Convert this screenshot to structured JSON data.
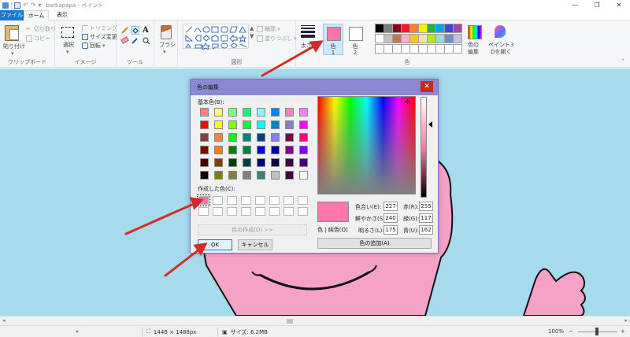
{
  "window": {
    "title": "barbapapa - ペイント",
    "controls": [
      "—",
      "❐",
      "✕"
    ]
  },
  "tabs": {
    "file": "ファイル",
    "home": "ホーム",
    "view": "表示"
  },
  "ribbon": {
    "clipboard": {
      "paste": "貼り付け",
      "cut": "切り取り",
      "copy": "コピー",
      "label": "クリップボード"
    },
    "image": {
      "select": "選択",
      "crop": "トリミング",
      "resize": "サイズ変更",
      "rotate": "回転",
      "label": "イメージ"
    },
    "tools": {
      "label": "ツール"
    },
    "brush": {
      "label": "ブラシ"
    },
    "shapes": {
      "outline": "輪郭",
      "fill": "塗りつぶし",
      "label": "図形"
    },
    "size": {
      "label": "太さ"
    },
    "color1": {
      "label_line1": "色",
      "label_line2": "1",
      "color": "#ff77aa"
    },
    "color2": {
      "label_line1": "色",
      "label_line2": "2",
      "color": "#ffffff"
    },
    "colors": {
      "label": "色"
    },
    "edit_colors": {
      "line1": "色の",
      "line2": "編集"
    },
    "paint3d": {
      "line1": "ペイント3",
      "line2": "Dを開く"
    },
    "palette_row1": [
      "#000000",
      "#7f7f7f",
      "#880015",
      "#ed1c24",
      "#ff7f27",
      "#fff200",
      "#22b14c",
      "#00a2e8",
      "#3f48cc",
      "#a349a4"
    ],
    "palette_row2": [
      "#ffffff",
      "#c3c3c3",
      "#b97a57",
      "#ffaec9",
      "#ffc90e",
      "#efe4b0",
      "#b5e61d",
      "#99d9ea",
      "#7092be",
      "#c8bfe7"
    ],
    "palette_row3": [
      "#ffffff",
      "#ffffff",
      "#ffffff",
      "#ffffff",
      "#ffffff",
      "#ffffff",
      "#ffffff",
      "#ffffff",
      "#ffffff",
      "#ffffff"
    ]
  },
  "canvas": {
    "background": "#a6daed",
    "figure_color": "#f6a2c7"
  },
  "status": {
    "dimensions": "1446 × 1488px",
    "size": "サイズ: 6.2MB",
    "zoom": "100%"
  },
  "dialog": {
    "title": "色の編集",
    "basic_colors_label": "基本色(B):",
    "basic_colors": [
      [
        "#ff8080",
        "#ffff80",
        "#80ff80",
        "#00ff80",
        "#80ffff",
        "#0080ff",
        "#ff80c0",
        "#ff80ff"
      ],
      [
        "#ff0000",
        "#ffff00",
        "#80ff00",
        "#00ff40",
        "#00ffff",
        "#0080c0",
        "#8080c0",
        "#ff00ff"
      ],
      [
        "#804040",
        "#ff8040",
        "#00ff00",
        "#008080",
        "#004080",
        "#8080ff",
        "#800040",
        "#ff0080"
      ],
      [
        "#800000",
        "#ff8000",
        "#008000",
        "#008040",
        "#0000ff",
        "#0000a0",
        "#800080",
        "#8000ff"
      ],
      [
        "#400000",
        "#804000",
        "#004000",
        "#004040",
        "#000080",
        "#000040",
        "#400040",
        "#400080"
      ],
      [
        "#000000",
        "#808000",
        "#808040",
        "#808080",
        "#408080",
        "#c0c0c0",
        "#400040",
        "#ffffff"
      ]
    ],
    "custom_colors_label": "作成した色(C):",
    "define_custom": "色の作成(D) >>",
    "ok": "OK",
    "cancel": "キャンセル",
    "color_solid": "色 | 純色(O)",
    "add_to_custom": "色の追加(A)",
    "preview_color": "#ff77aa",
    "fields": {
      "hue_label": "色合い(E):",
      "hue": "227",
      "sat_label": "鮮やかさ(S):",
      "sat": "240",
      "lum_label": "明るさ(L):",
      "lum": "175",
      "red_label": "赤(R):",
      "red": "255",
      "green_label": "緑(G):",
      "green": "117",
      "blue_label": "青(U):",
      "blue": "162"
    }
  }
}
